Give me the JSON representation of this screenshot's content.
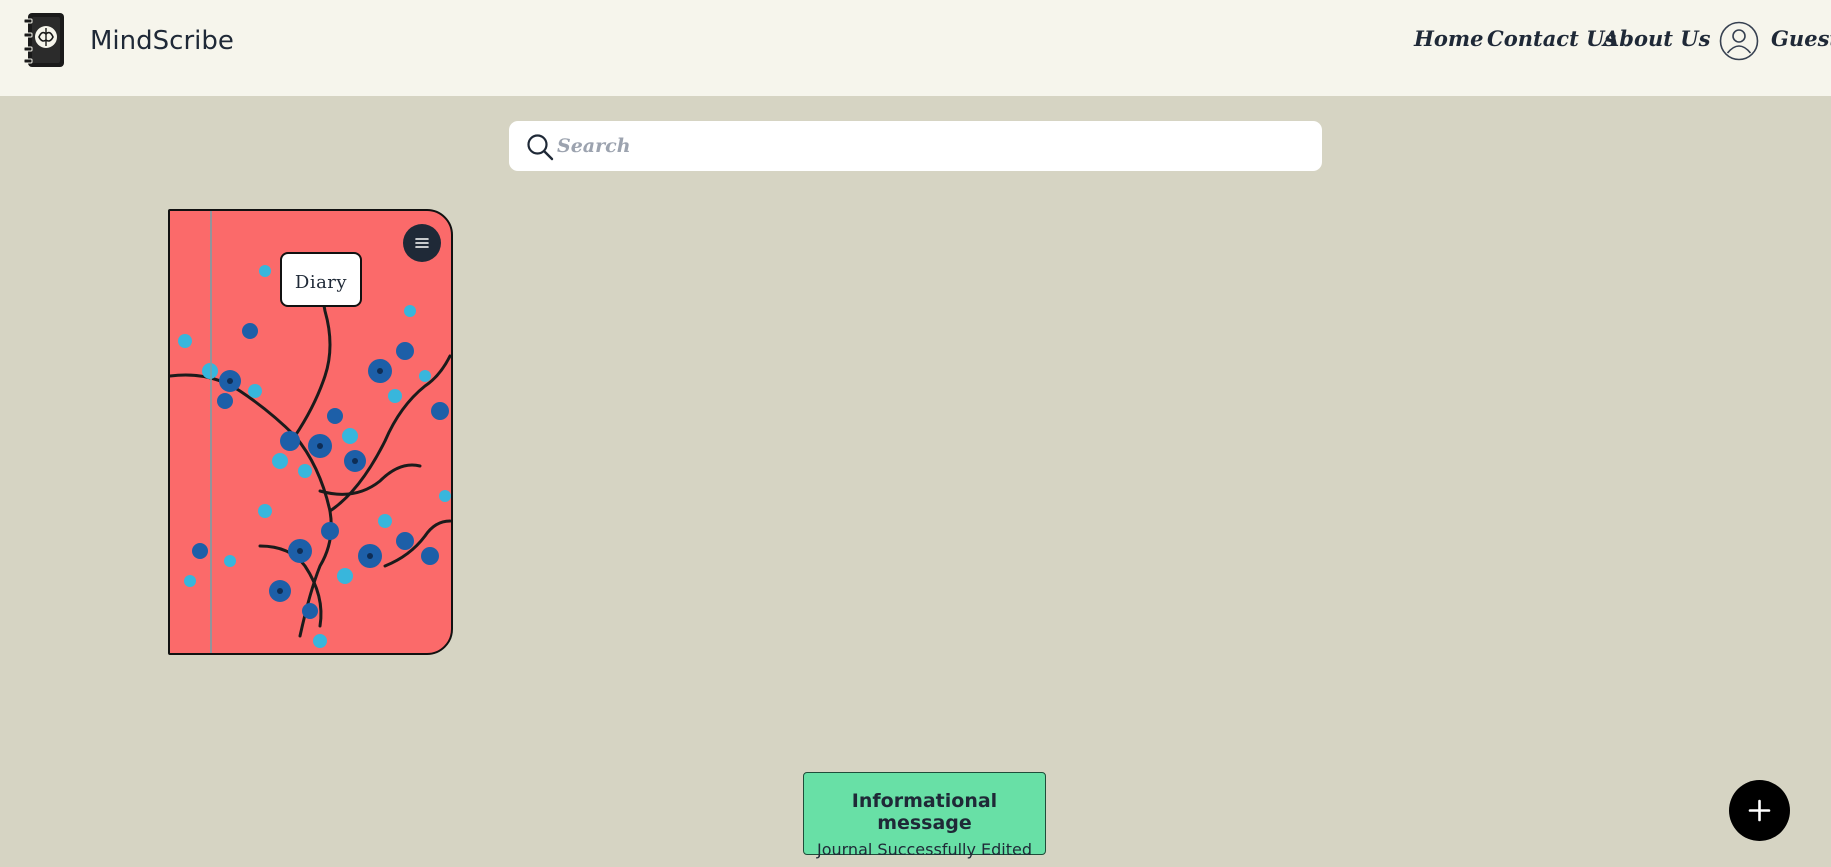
{
  "header": {
    "brand": "MindScribe",
    "nav": {
      "home": "Home",
      "contact": "Contact Us",
      "about": "About Us"
    },
    "user_label": "Guest"
  },
  "search": {
    "placeholder": "Search",
    "value": ""
  },
  "journals": [
    {
      "title": "Diary",
      "cover_color": "#fb6a6a"
    }
  ],
  "toast": {
    "title": "Informational message",
    "body": "Journal Successfully Edited",
    "color": "#68e0a6"
  },
  "icons": {
    "logo": "journal-brain-icon",
    "user": "user-circle-icon",
    "search": "search-icon",
    "menu": "hamburger-menu-icon",
    "add": "plus-icon"
  }
}
